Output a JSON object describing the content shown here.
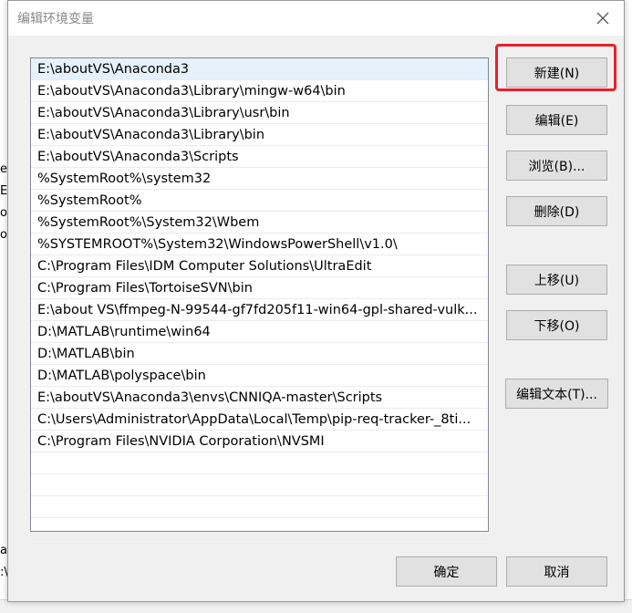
{
  "dialog": {
    "title": "编辑环境变量",
    "close_icon": "close-icon"
  },
  "path_list": {
    "items": [
      "E:\\aboutVS\\Anaconda3",
      "E:\\aboutVS\\Anaconda3\\Library\\mingw-w64\\bin",
      "E:\\aboutVS\\Anaconda3\\Library\\usr\\bin",
      "E:\\aboutVS\\Anaconda3\\Library\\bin",
      "E:\\aboutVS\\Anaconda3\\Scripts",
      "%SystemRoot%\\system32",
      "%SystemRoot%",
      "%SystemRoot%\\System32\\Wbem",
      "%SYSTEMROOT%\\System32\\WindowsPowerShell\\v1.0\\",
      "C:\\Program Files\\IDM Computer Solutions\\UltraEdit",
      "C:\\Program Files\\TortoiseSVN\\bin",
      "E:\\about VS\\ffmpeg-N-99544-gf7fd205f11-win64-gpl-shared-vulk...",
      "D:\\MATLAB\\runtime\\win64",
      "D:\\MATLAB\\bin",
      "D:\\MATLAB\\polyspace\\bin",
      "E:\\aboutVS\\Anaconda3\\envs\\CNNIQA-master\\Scripts",
      "C:\\Users\\Administrator\\AppData\\Local\\Temp\\pip-req-tracker-_8ti...",
      "C:\\Program Files\\NVIDIA Corporation\\NVSMI"
    ],
    "empty_rows": 4
  },
  "buttons": {
    "new": "新建(N)",
    "edit": "编辑(E)",
    "browse": "浏览(B)...",
    "delete": "删除(D)",
    "move_up": "上移(U)",
    "move_down": "下移(O)",
    "edit_text": "编辑文本(T)...",
    "ok": "确定",
    "cancel": "取消"
  },
  "background": {
    "fragments": [
      "e",
      "Ec",
      "o",
      "o",
      "a",
      ":\\"
    ]
  },
  "colors": {
    "highlight": "#e8202a",
    "selected_row": "#e5f1fb"
  }
}
